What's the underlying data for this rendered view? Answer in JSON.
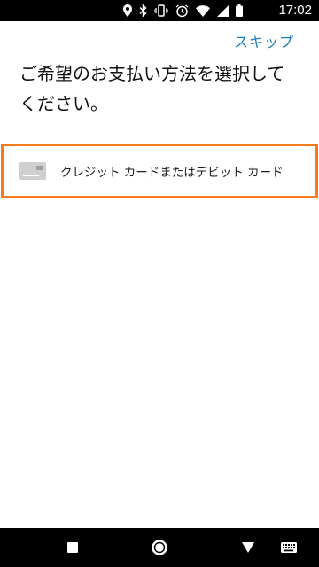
{
  "status_bar": {
    "time": "17:02",
    "icons": [
      "location-icon",
      "bluetooth-icon",
      "vibrate-icon",
      "alarm-icon",
      "wifi-icon",
      "signal-icon",
      "battery-icon"
    ]
  },
  "header": {
    "skip_label": "スキップ"
  },
  "main": {
    "title": "ご希望のお支払い方法を選択してください。",
    "payment_options": [
      {
        "label": "クレジット カードまたはデビット カード",
        "icon": "credit-card-icon"
      }
    ],
    "accent_color": "#f47b20",
    "link_color": "#1a7db6"
  },
  "nav_bar": {
    "buttons": [
      "recent-apps-icon",
      "home-icon",
      "back-icon",
      "keyboard-icon"
    ]
  }
}
